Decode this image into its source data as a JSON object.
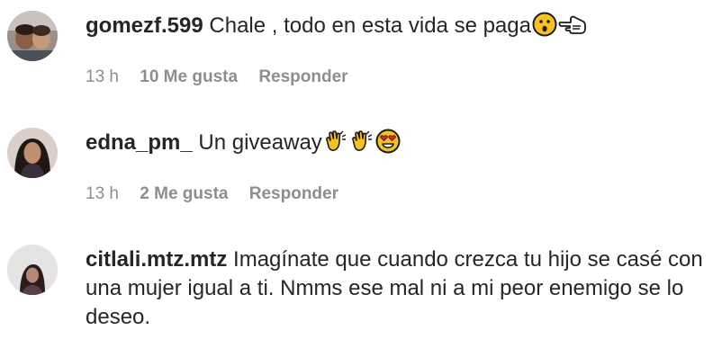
{
  "comments": [
    {
      "username": "gomezf.599",
      "text": "Chale , todo en esta vida se paga",
      "emojis": [
        "hushed-face-emoji",
        "left-pointing-hand-emoji"
      ],
      "time": "13 h",
      "likes": "10 Me gusta",
      "reply": "Responder"
    },
    {
      "username": "edna_pm_",
      "text": "Un giveaway",
      "emojis": [
        "clapping-hands-emoji",
        "clapping-hands-emoji",
        "heart-eyes-emoji"
      ],
      "time": "13 h",
      "likes": "2 Me gusta",
      "reply": "Responder"
    },
    {
      "username": "citlali.mtz.mtz",
      "text_line1": "Imagínate que cuando crezca tu hijo se casé con",
      "text_line2": "una mujer igual a ti. Nmms ese mal ni a mi peor enemigo se lo",
      "text_line3": "deseo."
    }
  ],
  "colors": {
    "text": "#262626",
    "meta": "#8e8e8e",
    "emoji_yellow": "#f7c21d"
  }
}
